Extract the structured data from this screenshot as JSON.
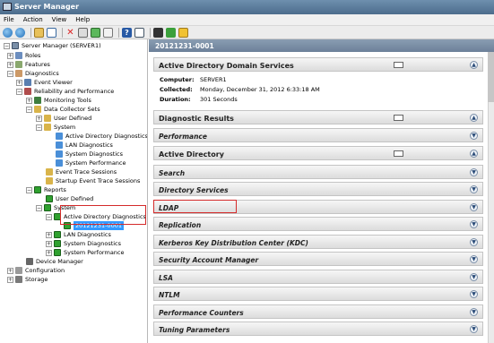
{
  "window": {
    "title": "Server Manager"
  },
  "menu": [
    "File",
    "Action",
    "View",
    "Help"
  ],
  "tree": {
    "root": "Server Manager (SERVER1)",
    "roles": "Roles",
    "features": "Features",
    "diagnostics": "Diagnostics",
    "event_viewer": "Event Viewer",
    "reliability": "Reliability and Performance",
    "monitoring_tools": "Monitoring Tools",
    "data_collector_sets": "Data Collector Sets",
    "user_defined": "User Defined",
    "system": "System",
    "dcs_items": [
      "Active Directory Diagnostics",
      "LAN Diagnostics",
      "System Diagnostics",
      "System Performance"
    ],
    "event_trace": "Event Trace Sessions",
    "startup_trace": "Startup Event Trace Sessions",
    "reports": "Reports",
    "reports_user_defined": "User Defined",
    "reports_system": "System",
    "report_ad": "Active Directory Diagnostics",
    "report_selected": "20121231-0001",
    "report_items": [
      "LAN Diagnostics",
      "System Diagnostics",
      "System Performance"
    ],
    "device_manager": "Device Manager",
    "configuration": "Configuration",
    "storage": "Storage"
  },
  "report": {
    "header": "20121231-0001",
    "title": "Active Directory Domain Services",
    "computer_label": "Computer:",
    "computer": "SERVER1",
    "collected_label": "Collected:",
    "collected": "Monday, December 31, 2012 6:33:18 AM",
    "duration_label": "Duration:",
    "duration": "301 Seconds",
    "sections": [
      "Diagnostic Results",
      "Performance",
      "Active Directory",
      "Search",
      "Directory Services",
      "LDAP",
      "Replication",
      "Kerberos Key Distribution Center (KDC)",
      "Security Account Manager",
      "LSA",
      "NTLM",
      "Performance Counters",
      "Tuning Parameters"
    ]
  },
  "colors": {
    "highlight_box": "#d42a2a",
    "selected": "#3399ff"
  }
}
